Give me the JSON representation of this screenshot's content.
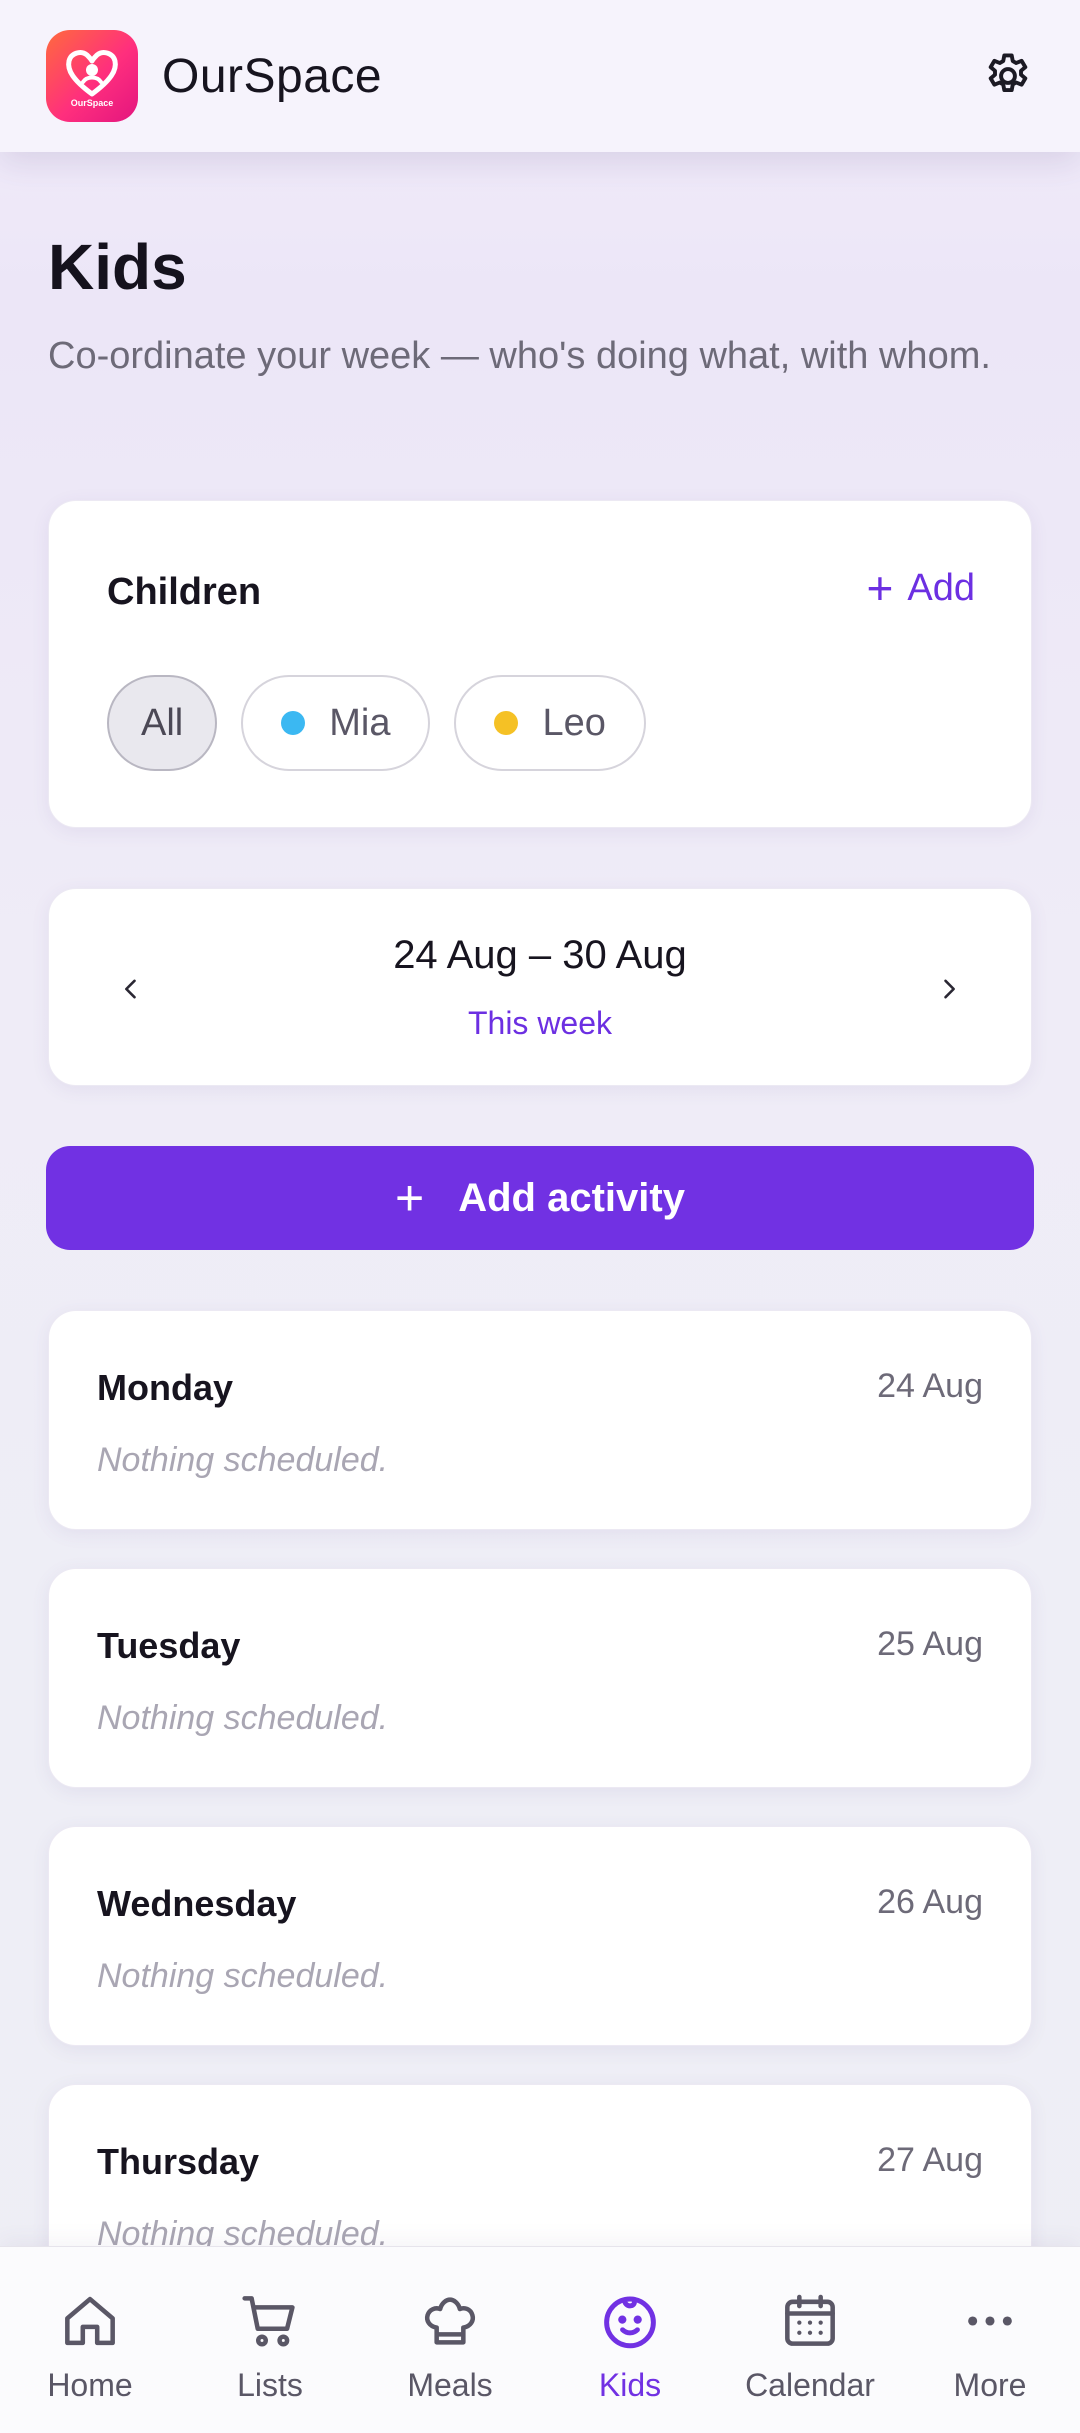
{
  "app": {
    "name": "OurSpace",
    "logo_text": "OurSpace"
  },
  "page": {
    "title": "Kids",
    "subtitle": "Co-ordinate your week — who's doing what, with whom."
  },
  "children": {
    "title": "Children",
    "add_label": "Add",
    "chips": [
      {
        "label": "All",
        "active": true
      },
      {
        "label": "Mia",
        "color": "#3bb8f2"
      },
      {
        "label": "Leo",
        "color": "#f5c125"
      }
    ]
  },
  "week": {
    "range": "24 Aug – 30 Aug",
    "label": "This week"
  },
  "add_activity_label": "Add activity",
  "days": [
    {
      "name": "Monday",
      "date": "24 Aug",
      "empty": "Nothing scheduled."
    },
    {
      "name": "Tuesday",
      "date": "25 Aug",
      "empty": "Nothing scheduled."
    },
    {
      "name": "Wednesday",
      "date": "26 Aug",
      "empty": "Nothing scheduled."
    },
    {
      "name": "Thursday",
      "date": "27 Aug",
      "empty": "Nothing scheduled."
    }
  ],
  "bottom_nav": [
    {
      "label": "Home",
      "icon": "home-icon"
    },
    {
      "label": "Lists",
      "icon": "cart-icon"
    },
    {
      "label": "Meals",
      "icon": "chef-hat-icon"
    },
    {
      "label": "Kids",
      "icon": "kid-face-icon",
      "active": true
    },
    {
      "label": "Calendar",
      "icon": "calendar-icon"
    },
    {
      "label": "More",
      "icon": "more-icon"
    }
  ],
  "colors": {
    "accent": "#7131e3",
    "logo_start": "#ff6a3d",
    "logo_end": "#e3157f"
  }
}
